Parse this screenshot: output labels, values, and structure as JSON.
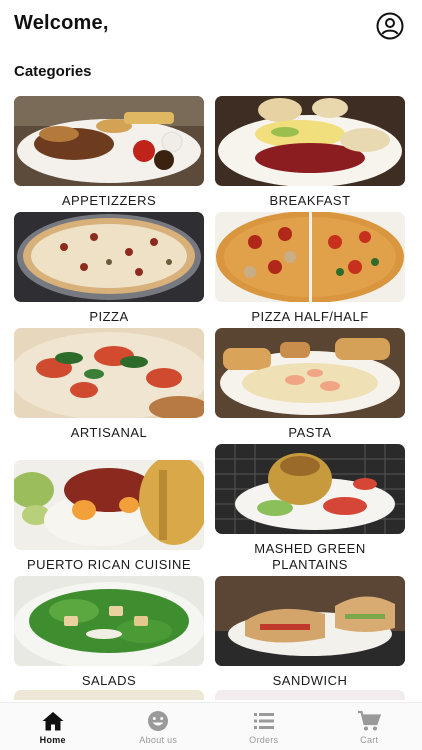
{
  "header": {
    "greeting": "Welcome,"
  },
  "section_title": "Categories",
  "categories": [
    {
      "label": "APPETIZZERS"
    },
    {
      "label": "BREAKFAST"
    },
    {
      "label": "PIZZA"
    },
    {
      "label": "PIZZA HALF/HALF"
    },
    {
      "label": "ARTISANAL"
    },
    {
      "label": "PASTA"
    },
    {
      "label": "PUERTO RICAN CUISINE"
    },
    {
      "label": "MASHED GREEN PLANTAINS"
    },
    {
      "label": "SALADS"
    },
    {
      "label": "SANDWICH"
    }
  ],
  "tabbar": {
    "items": [
      {
        "label": "Home",
        "icon": "home-icon",
        "active": true
      },
      {
        "label": "About us",
        "icon": "smiley-icon",
        "active": false
      },
      {
        "label": "Orders",
        "icon": "list-icon",
        "active": false
      },
      {
        "label": "Cart",
        "icon": "cart-icon",
        "active": false
      }
    ]
  }
}
